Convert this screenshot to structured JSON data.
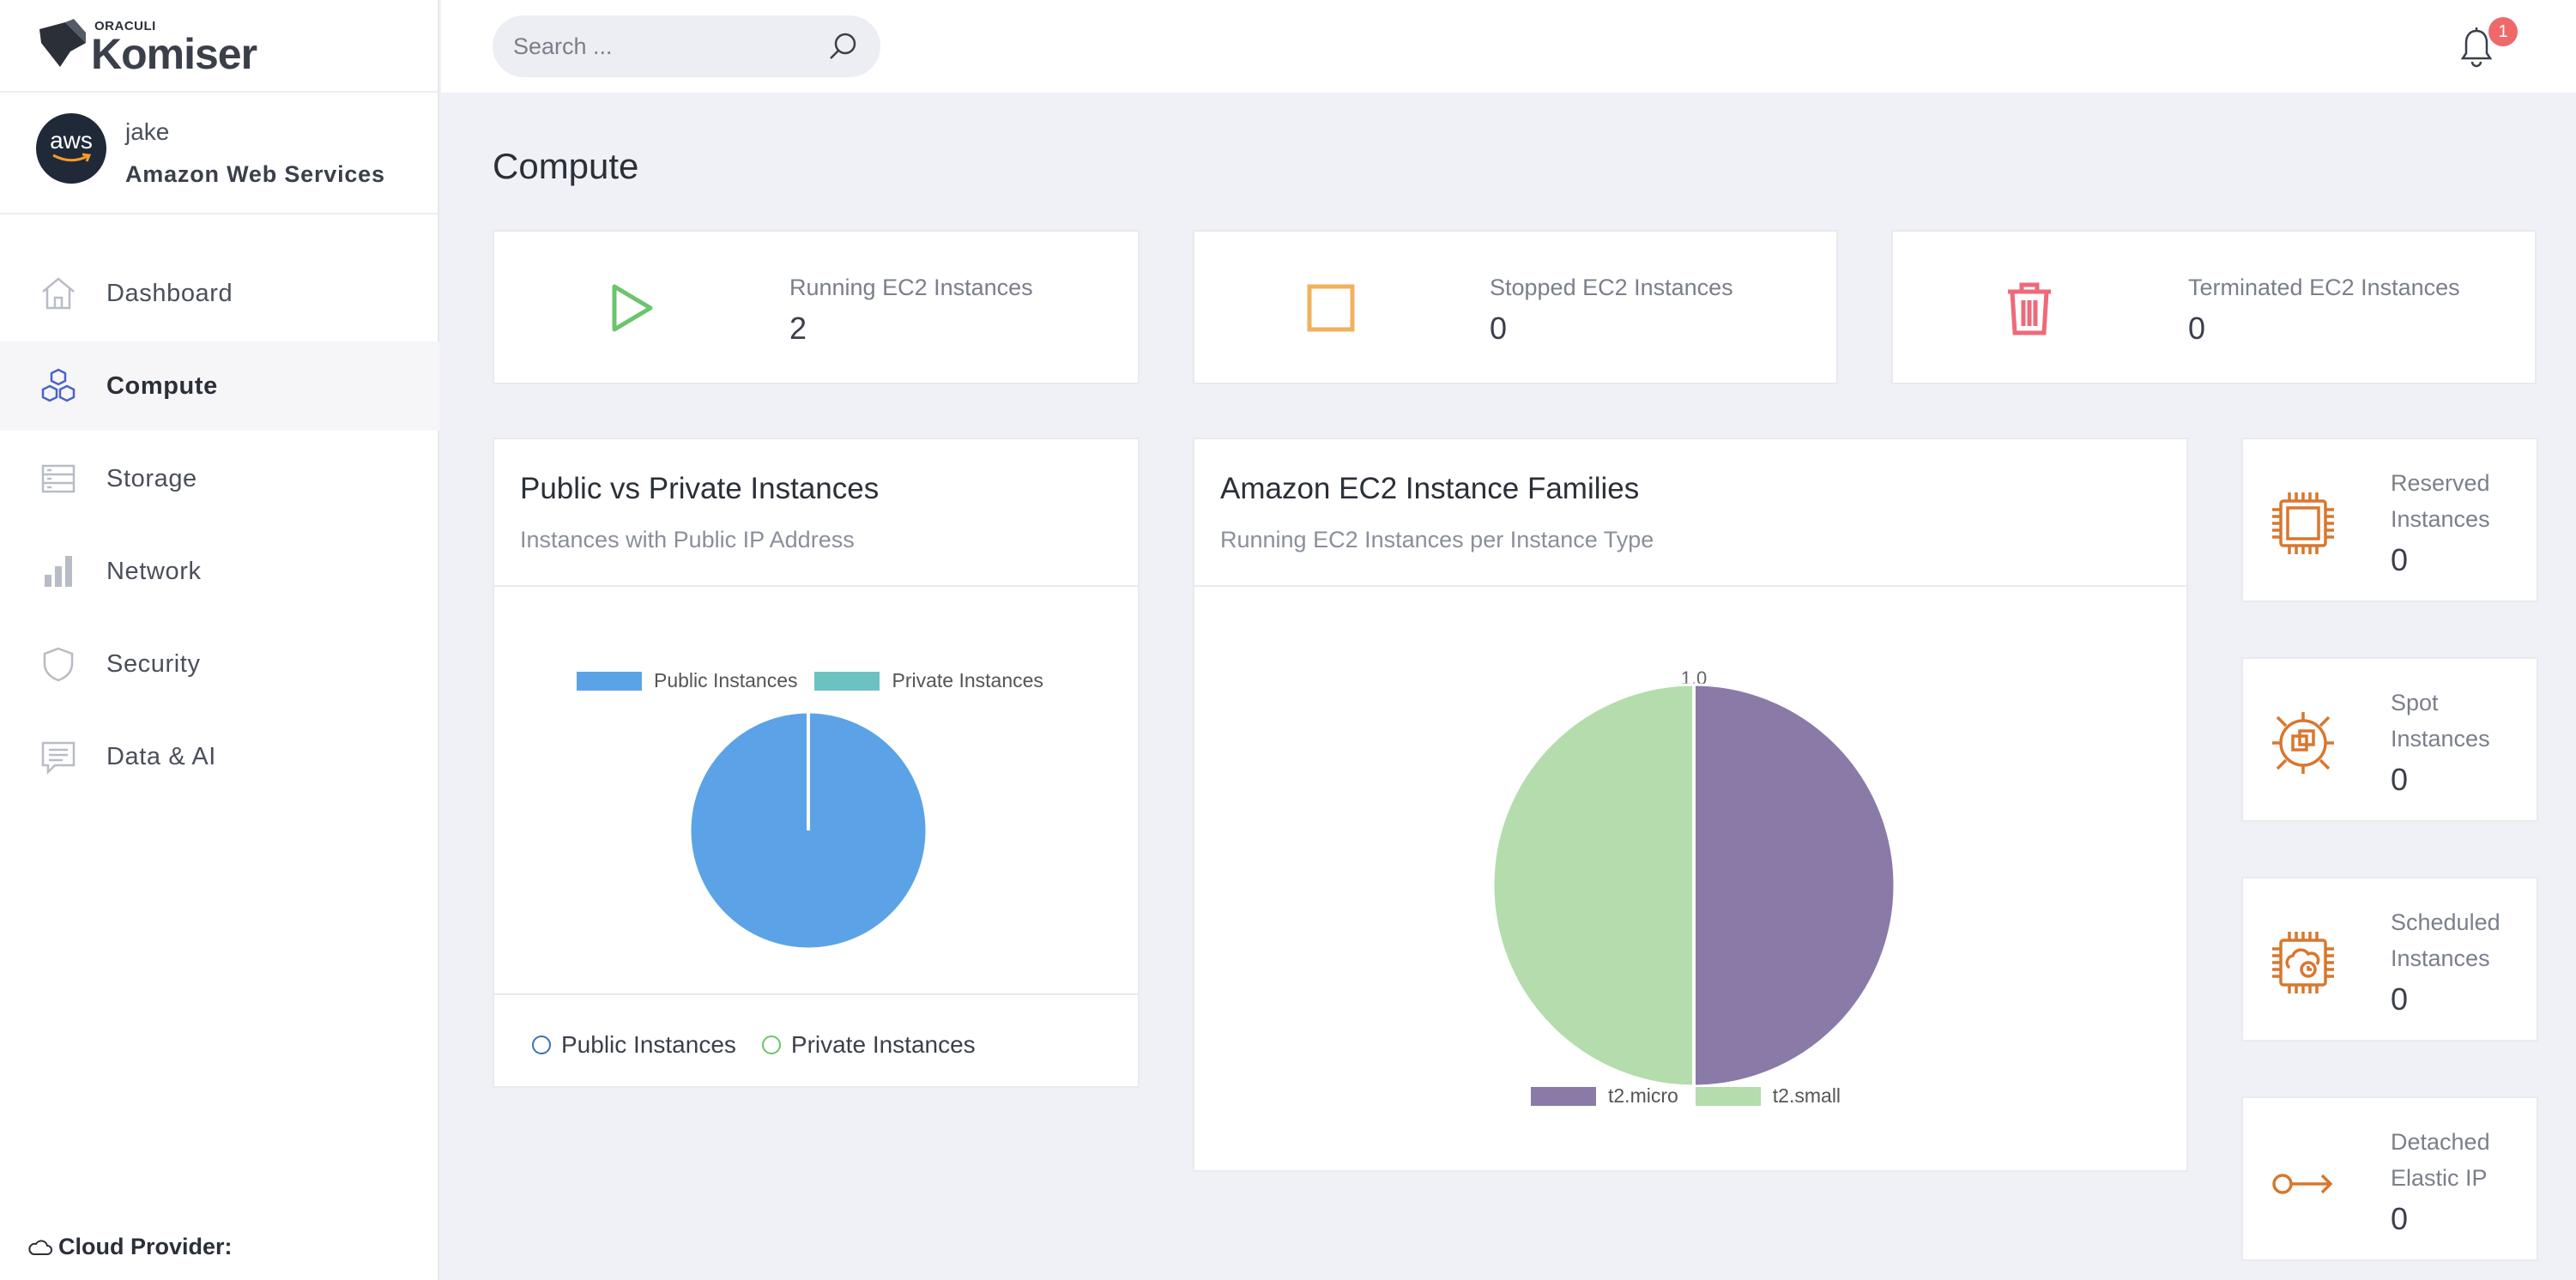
{
  "brand": {
    "company": "ORACULI",
    "name": "Komiser"
  },
  "account": {
    "user": "jake",
    "provider": "Amazon Web Services",
    "avatar_text": "aws"
  },
  "nav": {
    "items": [
      {
        "label": "Dashboard",
        "icon": "home-icon",
        "active": false
      },
      {
        "label": "Compute",
        "icon": "cubes-icon",
        "active": true
      },
      {
        "label": "Storage",
        "icon": "storage-icon",
        "active": false
      },
      {
        "label": "Network",
        "icon": "bar-chart-icon",
        "active": false
      },
      {
        "label": "Security",
        "icon": "shield-icon",
        "active": false
      },
      {
        "label": "Data & AI",
        "icon": "message-icon",
        "active": false
      }
    ]
  },
  "footer": {
    "cloud_provider_label": "Cloud Provider:"
  },
  "search": {
    "placeholder": "Search ..."
  },
  "notifications": {
    "count": "1"
  },
  "page": {
    "title": "Compute"
  },
  "stats": [
    {
      "label": "Running EC2 Instances",
      "value": "2",
      "icon": "play-icon",
      "color": "#6cc46e"
    },
    {
      "label": "Stopped EC2 Instances",
      "value": "0",
      "icon": "stop-icon",
      "color": "#f2b05e"
    },
    {
      "label": "Terminated EC2 Instances",
      "value": "0",
      "icon": "trash-icon",
      "color": "#ee6a79"
    }
  ],
  "public_private": {
    "title": "Public vs Private Instances",
    "subtitle": "Instances with Public IP Address",
    "legend": [
      "Public Instances",
      "Private Instances"
    ],
    "footer_legend": [
      "Public Instances",
      "Private Instances"
    ]
  },
  "families": {
    "title": "Amazon EC2 Instance Families",
    "subtitle": "Running EC2 Instances per Instance Type",
    "legend": [
      "t2.micro",
      "t2.small"
    ],
    "top_label": "1.0"
  },
  "side_stats": [
    {
      "label": "Reserved Instances",
      "value": "0",
      "icon": "chip-icon"
    },
    {
      "label": "Spot Instances",
      "value": "0",
      "icon": "spot-target-icon"
    },
    {
      "label": "Scheduled Instances",
      "value": "0",
      "icon": "scheduled-chip-icon"
    },
    {
      "label": "Detached Elastic IP",
      "value": "0",
      "icon": "key-arrow-icon"
    }
  ],
  "colors": {
    "public": "#5ba3e6",
    "private": "#6cc2c0",
    "t2_micro": "#8a7aa8",
    "t2_small": "#b4dcad",
    "accent_orange": "#d8772e",
    "nav_active_icon": "#4a63c9"
  },
  "chart_data": [
    {
      "type": "pie",
      "title": "Public vs Private Instances",
      "subtitle": "Instances with Public IP Address",
      "categories": [
        "Public Instances",
        "Private Instances"
      ],
      "values": [
        2,
        0
      ],
      "legend": "top"
    },
    {
      "type": "pie",
      "title": "Amazon EC2 Instance Families",
      "subtitle": "Running EC2 Instances per Instance Type",
      "categories": [
        "t2.micro",
        "t2.small"
      ],
      "values": [
        1,
        1
      ],
      "legend": "bottom"
    }
  ]
}
